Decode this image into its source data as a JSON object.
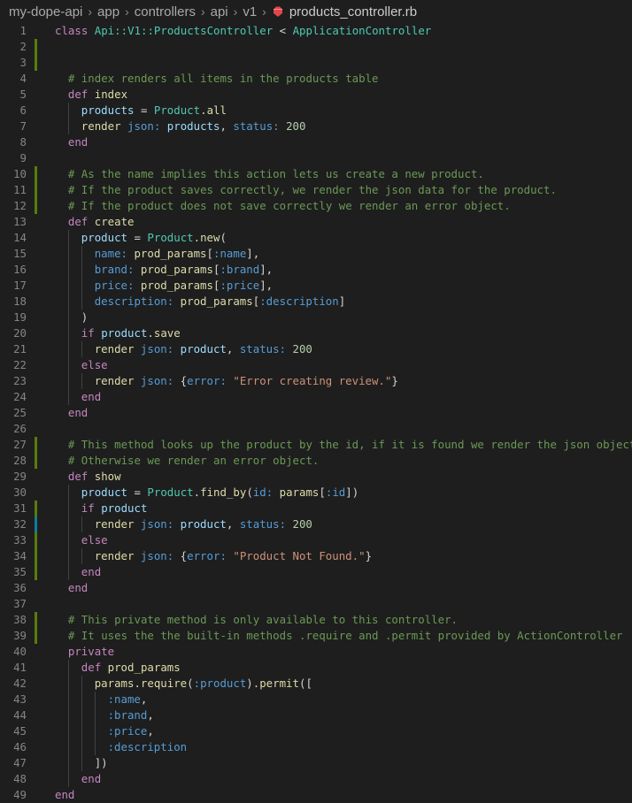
{
  "breadcrumb": {
    "items": [
      "my-dope-api",
      "app",
      "controllers",
      "api",
      "v1"
    ],
    "file": "products_controller.rb",
    "separator": "›",
    "file_icon": "ruby-icon"
  },
  "colors": {
    "background": "#1e1e1e",
    "line_number": "#858585",
    "keyword": "#c586c0",
    "class_name": "#4ec9b0",
    "function": "#dcdcaa",
    "variable": "#9cdcfe",
    "symbol": "#569cd6",
    "number": "#b5cea8",
    "string": "#ce9178",
    "comment": "#6a9955",
    "git_modified": "#0c7d9d",
    "git_added": "#587c0c"
  },
  "editor": {
    "lines": [
      {
        "n": "1",
        "indent": 0,
        "git": null,
        "t": [
          [
            "kw",
            "class "
          ],
          [
            "cls",
            "Api::V1::ProductsController"
          ],
          [
            "pun",
            " < "
          ],
          [
            "cls",
            "ApplicationController"
          ]
        ]
      },
      {
        "n": "2",
        "indent": 0,
        "git": "added",
        "t": []
      },
      {
        "n": "3",
        "indent": 1,
        "git": "added",
        "t": []
      },
      {
        "n": "4",
        "indent": 1,
        "git": null,
        "t": [
          [
            "cmt",
            "# index renders all items in the products table"
          ]
        ]
      },
      {
        "n": "5",
        "indent": 1,
        "git": null,
        "t": [
          [
            "kw",
            "def "
          ],
          [
            "fn",
            "index"
          ]
        ]
      },
      {
        "n": "6",
        "indent": 2,
        "git": null,
        "t": [
          [
            "var",
            "products"
          ],
          [
            "pun",
            " = "
          ],
          [
            "cls",
            "Product"
          ],
          [
            "pun",
            "."
          ],
          [
            "fn",
            "all"
          ]
        ]
      },
      {
        "n": "7",
        "indent": 2,
        "git": null,
        "t": [
          [
            "fn",
            "render "
          ],
          [
            "sym",
            "json: "
          ],
          [
            "var",
            "products"
          ],
          [
            "pun",
            ", "
          ],
          [
            "sym",
            "status: "
          ],
          [
            "num",
            "200"
          ]
        ]
      },
      {
        "n": "8",
        "indent": 1,
        "git": null,
        "t": [
          [
            "kw",
            "end"
          ]
        ]
      },
      {
        "n": "9",
        "indent": 1,
        "git": null,
        "t": []
      },
      {
        "n": "10",
        "indent": 1,
        "git": "added",
        "t": [
          [
            "cmt",
            "# As the name implies this action lets us create a new product."
          ]
        ]
      },
      {
        "n": "11",
        "indent": 1,
        "git": "added",
        "t": [
          [
            "cmt",
            "# If the product saves correctly, we render the json data for the product."
          ]
        ]
      },
      {
        "n": "12",
        "indent": 1,
        "git": "added",
        "t": [
          [
            "cmt",
            "# If the product does not save correctly we render an error object."
          ]
        ]
      },
      {
        "n": "13",
        "indent": 1,
        "git": null,
        "t": [
          [
            "kw",
            "def "
          ],
          [
            "fn",
            "create"
          ]
        ]
      },
      {
        "n": "14",
        "indent": 2,
        "git": null,
        "t": [
          [
            "var",
            "product"
          ],
          [
            "pun",
            " = "
          ],
          [
            "cls",
            "Product"
          ],
          [
            "pun",
            "."
          ],
          [
            "fn",
            "new"
          ],
          [
            "pun",
            "("
          ]
        ]
      },
      {
        "n": "15",
        "indent": 3,
        "git": null,
        "t": [
          [
            "sym",
            "name: "
          ],
          [
            "fn",
            "prod_params"
          ],
          [
            "pun",
            "["
          ],
          [
            "sym",
            ":name"
          ],
          [
            "pun",
            "],"
          ]
        ]
      },
      {
        "n": "16",
        "indent": 3,
        "git": null,
        "t": [
          [
            "sym",
            "brand: "
          ],
          [
            "fn",
            "prod_params"
          ],
          [
            "pun",
            "["
          ],
          [
            "sym",
            ":brand"
          ],
          [
            "pun",
            "],"
          ]
        ]
      },
      {
        "n": "17",
        "indent": 3,
        "git": null,
        "t": [
          [
            "sym",
            "price: "
          ],
          [
            "fn",
            "prod_params"
          ],
          [
            "pun",
            "["
          ],
          [
            "sym",
            ":price"
          ],
          [
            "pun",
            "],"
          ]
        ]
      },
      {
        "n": "18",
        "indent": 3,
        "git": null,
        "t": [
          [
            "sym",
            "description: "
          ],
          [
            "fn",
            "prod_params"
          ],
          [
            "pun",
            "["
          ],
          [
            "sym",
            ":description"
          ],
          [
            "pun",
            "]"
          ]
        ]
      },
      {
        "n": "19",
        "indent": 2,
        "git": null,
        "t": [
          [
            "pun",
            ")"
          ]
        ]
      },
      {
        "n": "20",
        "indent": 2,
        "git": null,
        "t": [
          [
            "kw",
            "if "
          ],
          [
            "var",
            "product"
          ],
          [
            "pun",
            "."
          ],
          [
            "fn",
            "save"
          ]
        ]
      },
      {
        "n": "21",
        "indent": 3,
        "git": null,
        "t": [
          [
            "fn",
            "render "
          ],
          [
            "sym",
            "json: "
          ],
          [
            "var",
            "product"
          ],
          [
            "pun",
            ", "
          ],
          [
            "sym",
            "status: "
          ],
          [
            "num",
            "200"
          ]
        ]
      },
      {
        "n": "22",
        "indent": 2,
        "git": null,
        "t": [
          [
            "kw",
            "else"
          ]
        ]
      },
      {
        "n": "23",
        "indent": 3,
        "git": null,
        "t": [
          [
            "fn",
            "render "
          ],
          [
            "sym",
            "json: "
          ],
          [
            "pun",
            "{"
          ],
          [
            "sym",
            "error: "
          ],
          [
            "str",
            "\"Error creating review.\""
          ],
          [
            "pun",
            "}"
          ]
        ]
      },
      {
        "n": "24",
        "indent": 2,
        "git": null,
        "t": [
          [
            "kw",
            "end"
          ]
        ]
      },
      {
        "n": "25",
        "indent": 1,
        "git": null,
        "t": [
          [
            "kw",
            "end"
          ]
        ]
      },
      {
        "n": "26",
        "indent": 1,
        "git": null,
        "t": []
      },
      {
        "n": "27",
        "indent": 1,
        "git": "added",
        "t": [
          [
            "cmt",
            "# This method looks up the product by the id, if it is found we render the json object"
          ]
        ]
      },
      {
        "n": "28",
        "indent": 1,
        "git": "added",
        "t": [
          [
            "cmt",
            "# Otherwise we render an error object."
          ]
        ]
      },
      {
        "n": "29",
        "indent": 1,
        "git": null,
        "t": [
          [
            "kw",
            "def "
          ],
          [
            "fn",
            "show"
          ]
        ]
      },
      {
        "n": "30",
        "indent": 2,
        "git": null,
        "t": [
          [
            "var",
            "product"
          ],
          [
            "pun",
            " = "
          ],
          [
            "cls",
            "Product"
          ],
          [
            "pun",
            "."
          ],
          [
            "fn",
            "find_by"
          ],
          [
            "pun",
            "("
          ],
          [
            "sym",
            "id: "
          ],
          [
            "fn",
            "params"
          ],
          [
            "pun",
            "["
          ],
          [
            "sym",
            ":id"
          ],
          [
            "pun",
            "])"
          ]
        ]
      },
      {
        "n": "31",
        "indent": 2,
        "git": "added",
        "t": [
          [
            "kw",
            "if "
          ],
          [
            "var",
            "product"
          ]
        ]
      },
      {
        "n": "32",
        "indent": 3,
        "git": "modified",
        "t": [
          [
            "fn",
            "render "
          ],
          [
            "sym",
            "json: "
          ],
          [
            "var",
            "product"
          ],
          [
            "pun",
            ", "
          ],
          [
            "sym",
            "status: "
          ],
          [
            "num",
            "200"
          ]
        ]
      },
      {
        "n": "33",
        "indent": 2,
        "git": "added",
        "t": [
          [
            "kw",
            "else"
          ]
        ]
      },
      {
        "n": "34",
        "indent": 3,
        "git": "added",
        "t": [
          [
            "fn",
            "render "
          ],
          [
            "sym",
            "json: "
          ],
          [
            "pun",
            "{"
          ],
          [
            "sym",
            "error: "
          ],
          [
            "str",
            "\"Product Not Found.\""
          ],
          [
            "pun",
            "}"
          ]
        ]
      },
      {
        "n": "35",
        "indent": 2,
        "git": "added",
        "t": [
          [
            "kw",
            "end"
          ]
        ]
      },
      {
        "n": "36",
        "indent": 1,
        "git": null,
        "t": [
          [
            "kw",
            "end"
          ]
        ]
      },
      {
        "n": "37",
        "indent": 1,
        "git": null,
        "t": []
      },
      {
        "n": "38",
        "indent": 1,
        "git": "added",
        "t": [
          [
            "cmt",
            "# This private method is only available to this controller."
          ]
        ]
      },
      {
        "n": "39",
        "indent": 1,
        "git": "added",
        "t": [
          [
            "cmt",
            "# It uses the the built-in methods .require and .permit provided by ActionController"
          ]
        ]
      },
      {
        "n": "40",
        "indent": 1,
        "git": null,
        "t": [
          [
            "kw",
            "private"
          ]
        ]
      },
      {
        "n": "41",
        "indent": 2,
        "git": null,
        "t": [
          [
            "kw",
            "def "
          ],
          [
            "fn",
            "prod_params"
          ]
        ]
      },
      {
        "n": "42",
        "indent": 3,
        "git": null,
        "t": [
          [
            "fn",
            "params"
          ],
          [
            "pun",
            "."
          ],
          [
            "fn",
            "require"
          ],
          [
            "pun",
            "("
          ],
          [
            "sym",
            ":product"
          ],
          [
            "pun",
            ")."
          ],
          [
            "fn",
            "permit"
          ],
          [
            "pun",
            "(["
          ]
        ]
      },
      {
        "n": "43",
        "indent": 4,
        "git": null,
        "t": [
          [
            "sym",
            ":name"
          ],
          [
            "pun",
            ","
          ]
        ]
      },
      {
        "n": "44",
        "indent": 4,
        "git": null,
        "t": [
          [
            "sym",
            ":brand"
          ],
          [
            "pun",
            ","
          ]
        ]
      },
      {
        "n": "45",
        "indent": 4,
        "git": null,
        "t": [
          [
            "sym",
            ":price"
          ],
          [
            "pun",
            ","
          ]
        ]
      },
      {
        "n": "46",
        "indent": 4,
        "git": null,
        "t": [
          [
            "sym",
            ":description"
          ]
        ]
      },
      {
        "n": "47",
        "indent": 3,
        "git": null,
        "t": [
          [
            "pun",
            "])"
          ]
        ]
      },
      {
        "n": "48",
        "indent": 2,
        "git": null,
        "t": [
          [
            "kw",
            "end"
          ]
        ]
      },
      {
        "n": "49",
        "indent": 0,
        "git": null,
        "t": [
          [
            "kw",
            "end"
          ]
        ]
      }
    ]
  }
}
